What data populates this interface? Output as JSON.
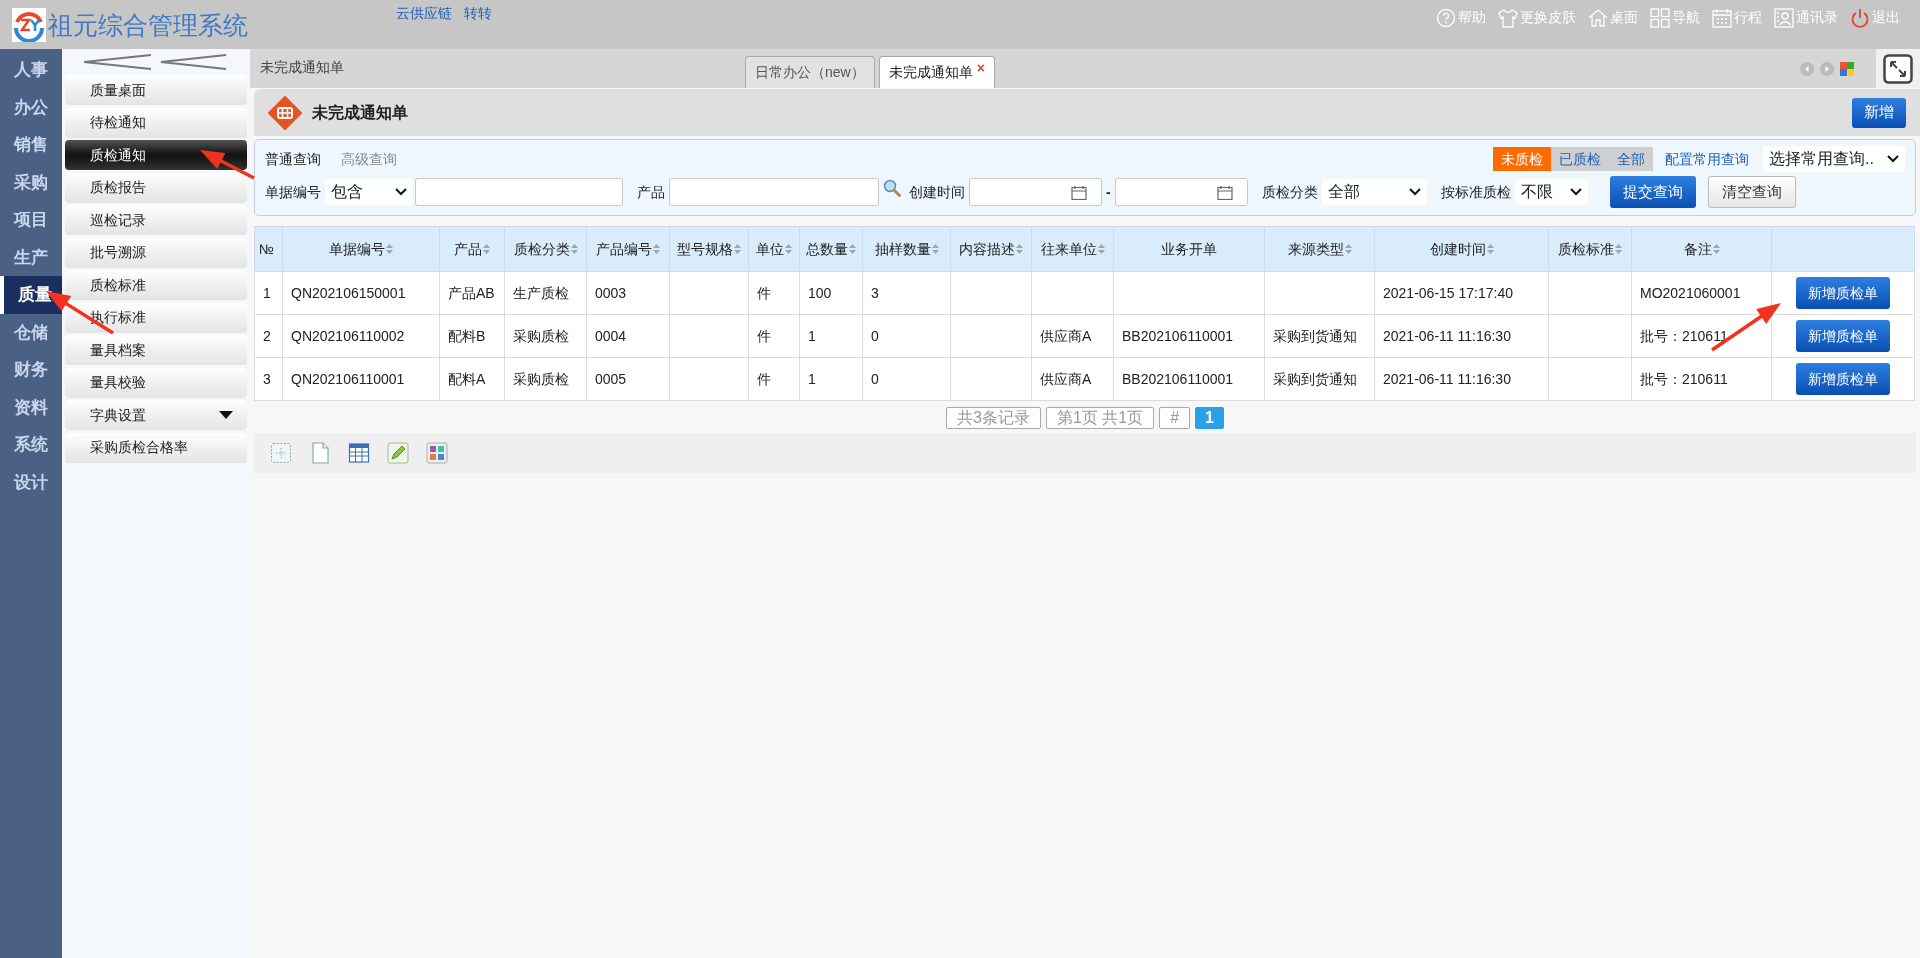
{
  "app": {
    "title": "祖元综合管理系统",
    "top_links": [
      "云供应链",
      "转转"
    ],
    "top_actions": [
      {
        "kind": "help",
        "label": "帮助"
      },
      {
        "kind": "shirt",
        "label": "更换皮肤"
      },
      {
        "kind": "home",
        "label": "桌面"
      },
      {
        "kind": "grid",
        "label": "导航"
      },
      {
        "kind": "calendar",
        "label": "行程"
      },
      {
        "kind": "contacts",
        "label": "通讯录"
      },
      {
        "kind": "power",
        "label": "退出"
      }
    ]
  },
  "nav": [
    {
      "label": "人事",
      "selected": false
    },
    {
      "label": "办公",
      "selected": false
    },
    {
      "label": "销售",
      "selected": false
    },
    {
      "label": "采购",
      "selected": false
    },
    {
      "label": "项目",
      "selected": false
    },
    {
      "label": "生产",
      "selected": false
    },
    {
      "label": "质量",
      "selected": true
    },
    {
      "label": "仓储",
      "selected": false
    },
    {
      "label": "财务",
      "selected": false
    },
    {
      "label": "资料",
      "selected": false
    },
    {
      "label": "系统",
      "selected": false
    },
    {
      "label": "设计",
      "selected": false
    }
  ],
  "submenu": [
    {
      "label": "质量桌面",
      "selected": false,
      "has_children": false
    },
    {
      "label": "待检通知",
      "selected": false,
      "has_children": false
    },
    {
      "label": "质检通知",
      "selected": true,
      "has_children": false
    },
    {
      "label": "质检报告",
      "selected": false,
      "has_children": false
    },
    {
      "label": "巡检记录",
      "selected": false,
      "has_children": false
    },
    {
      "label": "批号溯源",
      "selected": false,
      "has_children": false
    },
    {
      "label": "质检标准",
      "selected": false,
      "has_children": false
    },
    {
      "label": "执行标准",
      "selected": false,
      "has_children": false
    },
    {
      "label": "量具档案",
      "selected": false,
      "has_children": false
    },
    {
      "label": "量具校验",
      "selected": false,
      "has_children": false
    },
    {
      "label": "字典设置",
      "selected": false,
      "has_children": true
    },
    {
      "label": "采购质检合格率",
      "selected": false,
      "has_children": false
    }
  ],
  "breadcrumb": "未完成通知单",
  "tabs": [
    {
      "label": "日常办公（new）",
      "selected": false,
      "closable": false
    },
    {
      "label": "未完成通知单",
      "selected": true,
      "closable": true
    }
  ],
  "tab_close": "×",
  "page": {
    "title": "未完成通知单",
    "new_button": "新增"
  },
  "query": {
    "modes": [
      {
        "label": "普通查询",
        "selected": true
      },
      {
        "label": "高级查询",
        "selected": false
      }
    ],
    "status_filters": [
      {
        "label": "未质检",
        "selected": true
      },
      {
        "label": "已质检",
        "selected": false
      },
      {
        "label": "全部",
        "selected": false
      }
    ],
    "config_link": "配置常用查询",
    "saved_query": "选择常用查询..",
    "doc_no": {
      "label": "单据编号",
      "match": "包含"
    },
    "product": {
      "label": "产品"
    },
    "created": {
      "label": "创建时间",
      "separator": "-"
    },
    "category": {
      "label": "质检分类",
      "value": "全部"
    },
    "standard": {
      "label": "按标准质检",
      "value": "不限"
    },
    "submit": "提交查询",
    "clear": "清空查询"
  },
  "table": {
    "columns": [
      {
        "label": "№",
        "sortable": false
      },
      {
        "label": "单据编号",
        "sortable": true
      },
      {
        "label": "产品",
        "sortable": true
      },
      {
        "label": "质检分类",
        "sortable": true
      },
      {
        "label": "产品编号",
        "sortable": true
      },
      {
        "label": "型号规格",
        "sortable": true
      },
      {
        "label": "单位",
        "sortable": true
      },
      {
        "label": "总数量",
        "sortable": true
      },
      {
        "label": "抽样数量",
        "sortable": true
      },
      {
        "label": "内容描述",
        "sortable": true
      },
      {
        "label": "往来单位",
        "sortable": true
      },
      {
        "label": "业务开单",
        "sortable": false
      },
      {
        "label": "来源类型",
        "sortable": true
      },
      {
        "label": "创建时间",
        "sortable": true
      },
      {
        "label": "质检标准",
        "sortable": true
      },
      {
        "label": "备注",
        "sortable": true
      }
    ],
    "rows": [
      {
        "cells": [
          "1",
          "QN202106150001",
          "产品AB",
          "生产质检",
          "0003",
          "",
          "件",
          "100",
          "3",
          "",
          "",
          "",
          "",
          "2021-06-15 17:17:40",
          "",
          "MO2021060001"
        ],
        "action": "新增质检单"
      },
      {
        "cells": [
          "2",
          "QN202106110002",
          "配料B",
          "采购质检",
          "0004",
          "",
          "件",
          "1",
          "0",
          "",
          "供应商A",
          "BB202106110001",
          "采购到货通知",
          "2021-06-11 11:16:30",
          "",
          "批号：210611"
        ],
        "action": "新增质检单"
      },
      {
        "cells": [
          "3",
          "QN202106110001",
          "配料A",
          "采购质检",
          "0005",
          "",
          "件",
          "1",
          "0",
          "",
          "供应商A",
          "BB202106110001",
          "采购到货通知",
          "2021-06-11 11:16:30",
          "",
          "批号：210611"
        ],
        "action": "新增质检单"
      }
    ]
  },
  "pager": [
    {
      "label": "共3条记录",
      "selected": false
    },
    {
      "label": "第1页 共1页",
      "selected": false
    },
    {
      "label": "#",
      "selected": false
    },
    {
      "label": "1",
      "selected": true
    }
  ],
  "toolbar": [
    {
      "kind": "dotted"
    },
    {
      "kind": "page"
    },
    {
      "kind": "table"
    },
    {
      "kind": "pen"
    },
    {
      "kind": "puzzle"
    }
  ]
}
